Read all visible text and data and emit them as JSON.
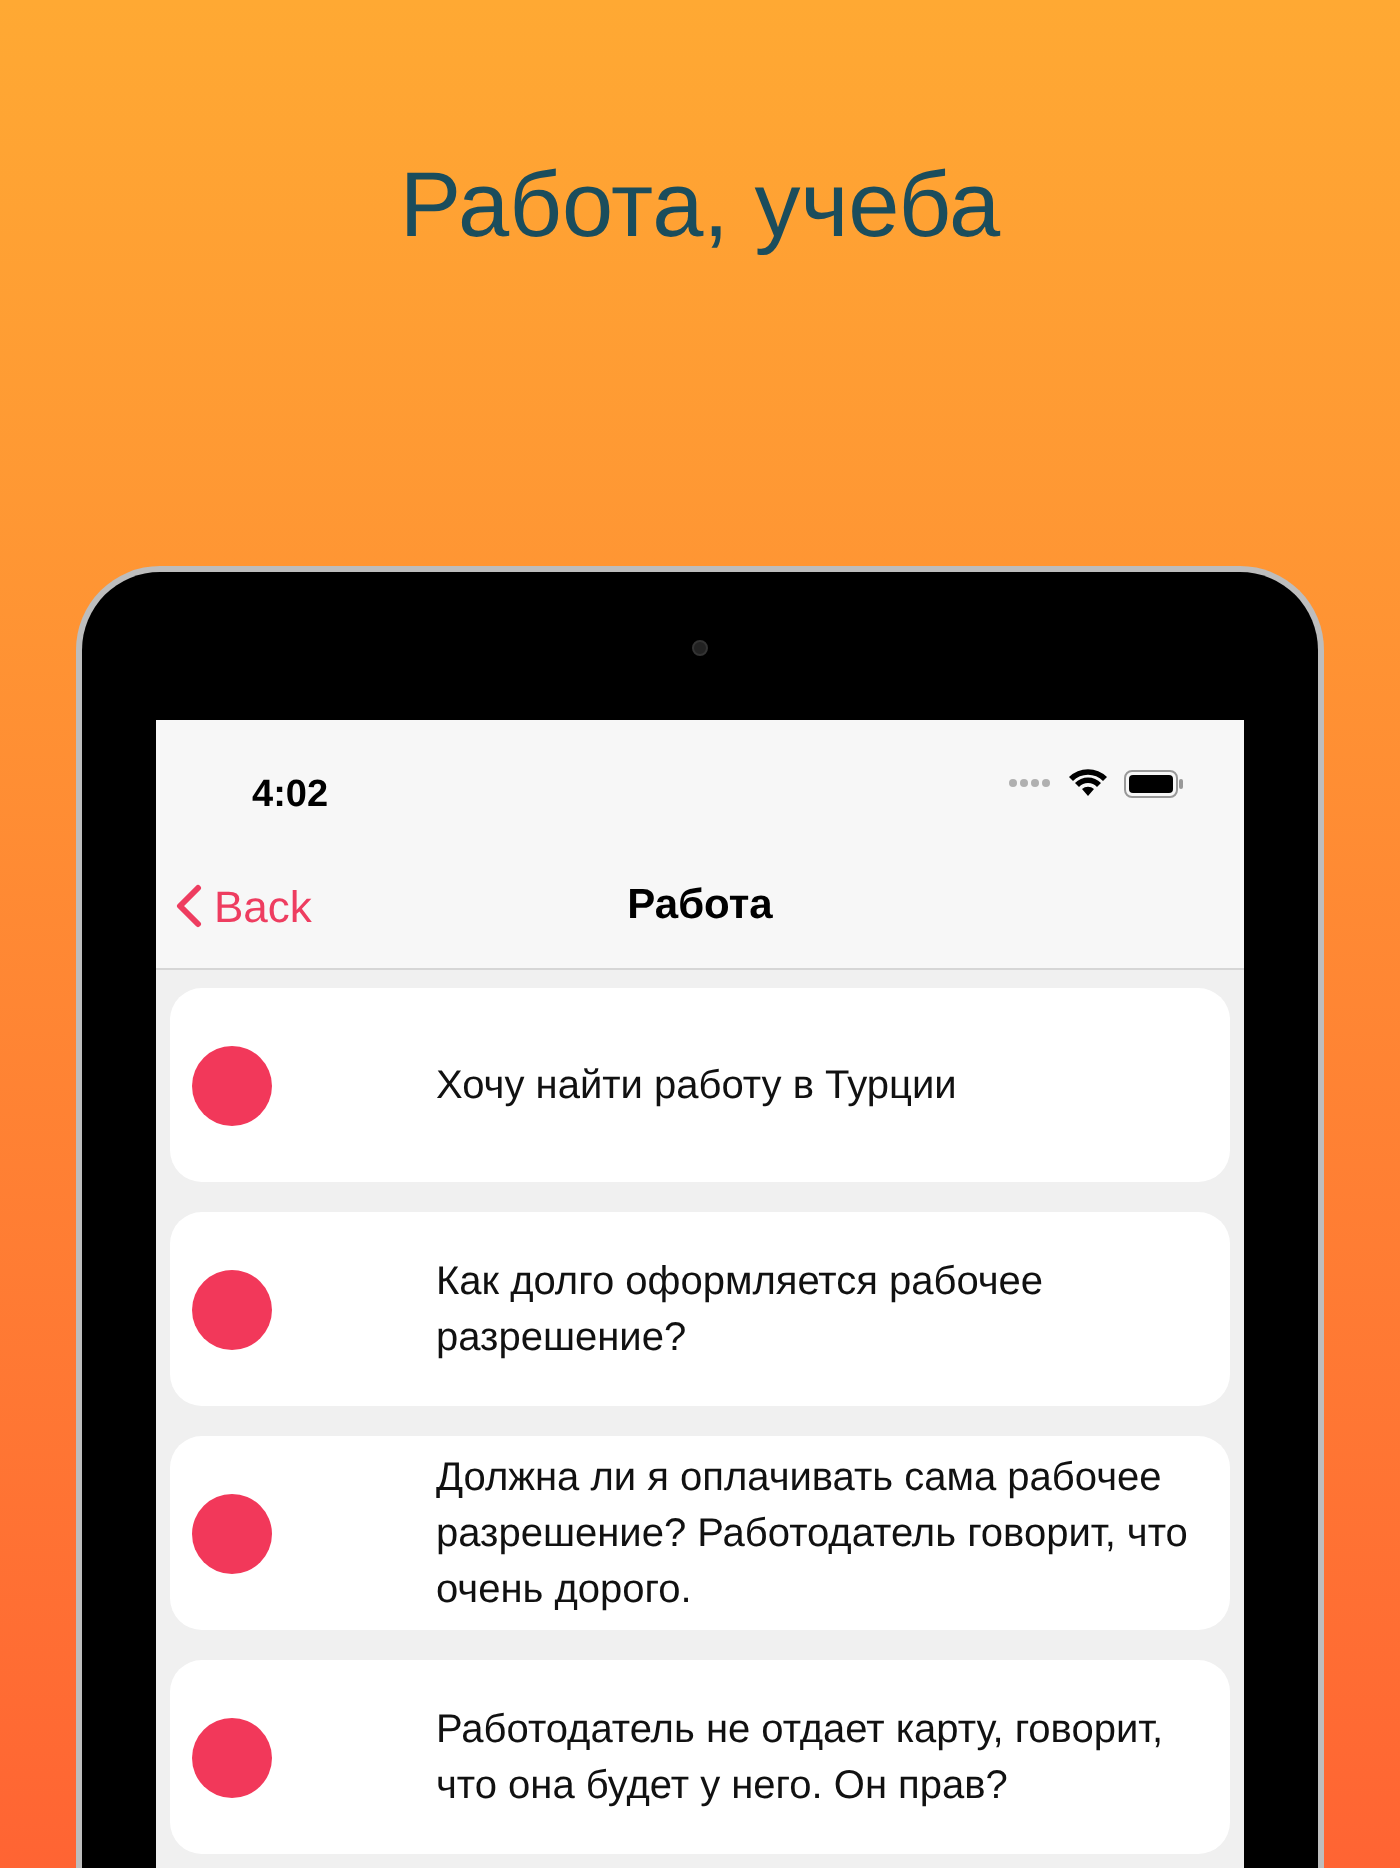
{
  "headline": "Работа, учеба",
  "status_bar": {
    "time": "4:02"
  },
  "nav": {
    "back": "Back",
    "title": "Работа"
  },
  "items": [
    {
      "text": "Хочу найти работу в Турции"
    },
    {
      "text": "Как долго оформляется рабочее разрешение?"
    },
    {
      "text": "Должна ли я оплачивать сама рабочее разрешение? Работодатель говорит, что очень дорого."
    },
    {
      "text": "Работодатель не отдает карту, говорит, что она будет у него. Он прав?"
    }
  ]
}
